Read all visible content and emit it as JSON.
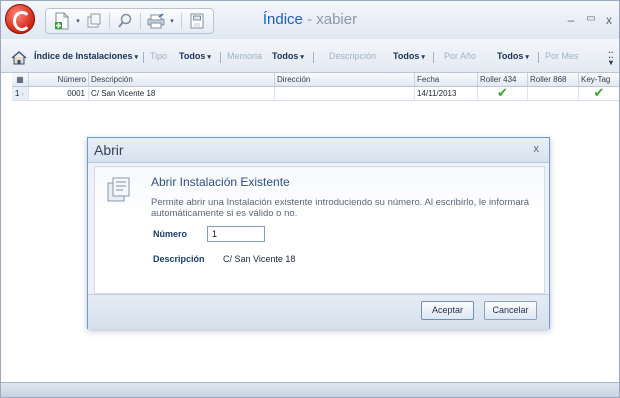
{
  "window": {
    "title_app": "Índice",
    "title_sep": " - ",
    "title_user": "xabier",
    "minimize": "–",
    "maximize": "▭",
    "close": "x"
  },
  "filterbar": {
    "root": "Índice de Instalaciones",
    "tipo": "Tipo",
    "todos": "Todos",
    "memoria": "Memoria",
    "descripcion": "Descripción",
    "por_anio": "Por Año",
    "por_mes": "Por Mes"
  },
  "grid": {
    "columns": [
      "Número",
      "Descripción",
      "Dirección",
      "Fecha",
      "Roller 434",
      "Roller 868",
      "Key-Tag"
    ],
    "rows": [
      {
        "index": "1",
        "numero": "0001",
        "descripcion": "C/ San Vicente 18",
        "direccion": "",
        "fecha": "14/11/2013",
        "roller434": "✔",
        "roller868": "",
        "keytag": "✔"
      }
    ]
  },
  "dialog": {
    "title": "Abrir",
    "close": "x",
    "heading": "Abrir Instalación Existente",
    "description": "Permite abrir una Instalación existente introduciendo su número. Al escribirlo, le informará automáticamente si es válido o no.",
    "numero_label": "Número",
    "numero_value": "1",
    "descripcion_label": "Descripción",
    "descripcion_value": "C/ San Vicente 18",
    "accept": "Aceptar",
    "cancel": "Cancelar"
  },
  "colors": {
    "accent": "#1f5fbf",
    "check": "#3aa52c",
    "orb": "#d42a18"
  },
  "icons": [
    "app-orb-icon",
    "new-document-icon",
    "open-icon",
    "search-icon",
    "print-icon",
    "save-icon",
    "home-icon",
    "dialog-folder-icon"
  ]
}
